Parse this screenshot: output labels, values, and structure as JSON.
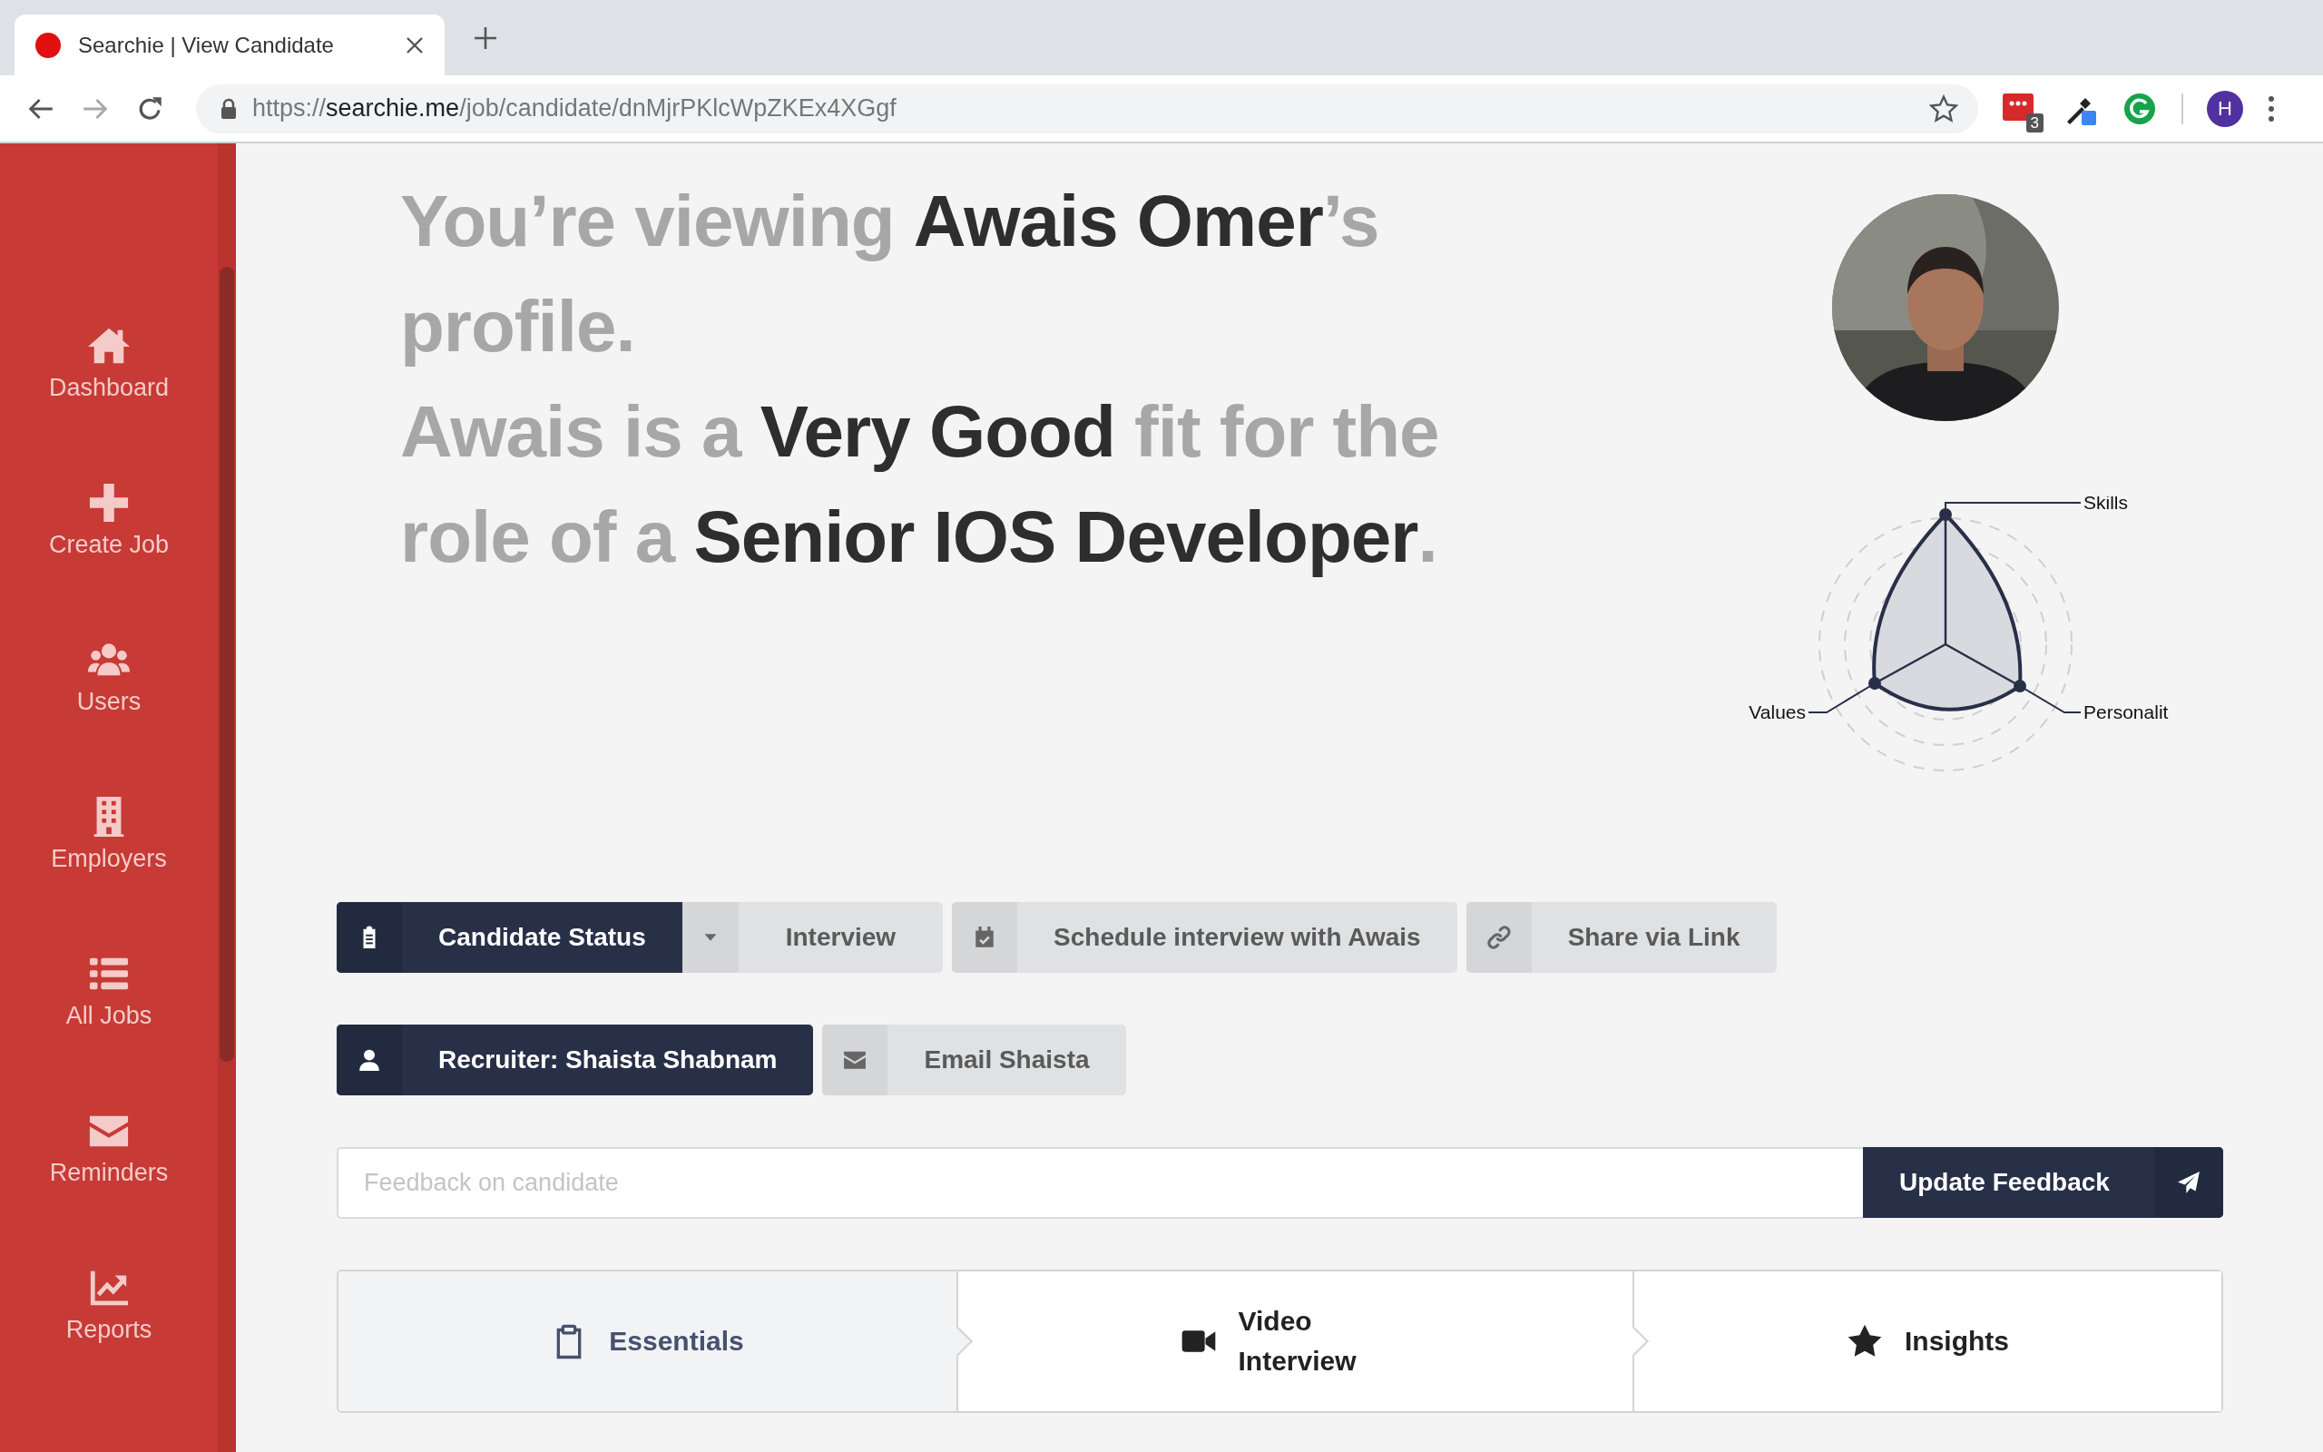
{
  "browser": {
    "tab_title": "Searchie | View Candidate",
    "url": "https://**searchie.me**/job/candidate/dnMjrPKlcWpZKEx4XGgf",
    "extension_badge": "3",
    "profile_initial": "H"
  },
  "sidebar": {
    "items": [
      {
        "label": "Dashboard"
      },
      {
        "label": "Create Job"
      },
      {
        "label": "Users"
      },
      {
        "label": "Employers"
      },
      {
        "label": "All Jobs"
      },
      {
        "label": "Reminders"
      },
      {
        "label": "Reports"
      }
    ]
  },
  "headline": {
    "lines": [
      "You’re viewing **Awais Omer**’s profile.",
      "Awais is a **Very Good** fit for the role of a **Senior IOS Developer**."
    ]
  },
  "radar": {
    "labels": [
      "Skills",
      "Personalit",
      "Values"
    ]
  },
  "action_rows": [
    [
      {
        "kind": "status",
        "label": "Candidate Status",
        "value": "Interview"
      },
      {
        "kind": "schedule",
        "label": "Schedule interview with Awais"
      },
      {
        "kind": "share",
        "label": "Share via Link"
      }
    ],
    [
      {
        "kind": "recruiter",
        "label": "Recruiter: Shaista Shabnam"
      },
      {
        "kind": "email",
        "label": "Email Shaista"
      }
    ]
  ],
  "feedback": {
    "placeholder": "Feedback on candidate",
    "button": "Update Feedback"
  },
  "tabs": [
    {
      "label": "Essentials",
      "selected": true
    },
    {
      "label": "Video Interview",
      "selected": false
    },
    {
      "label": "Insights",
      "selected": false
    }
  ]
}
